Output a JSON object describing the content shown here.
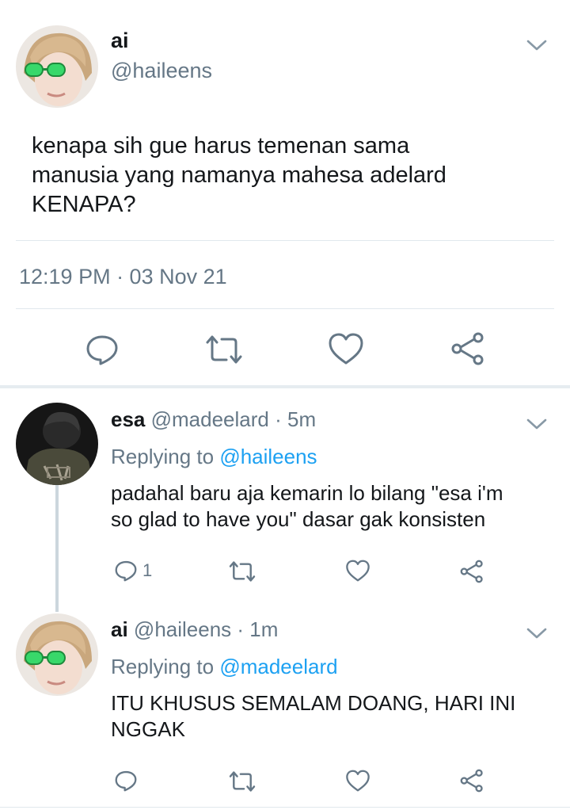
{
  "main_tweet": {
    "author_name": "ai",
    "author_handle": "@haileens",
    "text_lines": [
      "kenapa sih gue harus temenan sama",
      "manusia yang namanya mahesa adelard",
      "KENAPA?"
    ],
    "timestamp": "12:19 PM · 03 Nov 21"
  },
  "replies": [
    {
      "author_name": "esa",
      "author_handle": "@madeelard",
      "age": "· 5m",
      "replying_prefix": "Replying to",
      "replying_to": "@haileens",
      "text_lines": [
        "padahal baru aja kemarin lo bilang \"esa i'm",
        "so glad to have you\" dasar gak konsisten"
      ],
      "reply_count": "1"
    },
    {
      "author_name": "ai",
      "author_handle": "@haileens",
      "age": "· 1m",
      "replying_prefix": "Replying to",
      "replying_to": "@madeelard",
      "text_lines": [
        "ITU KHUSUS SEMALAM DOANG, HARI INI",
        "NGGAK"
      ],
      "reply_count": ""
    }
  ],
  "icons": {
    "reply": "reply-icon",
    "retweet": "retweet-icon",
    "like": "heart-icon",
    "share": "share-icon",
    "menu": "chevron-down-icon"
  },
  "colors": {
    "icon": "#657786",
    "accent": "#1da1f2",
    "divider": "#e1e8ed",
    "thread_line": "#ccd6dd"
  }
}
